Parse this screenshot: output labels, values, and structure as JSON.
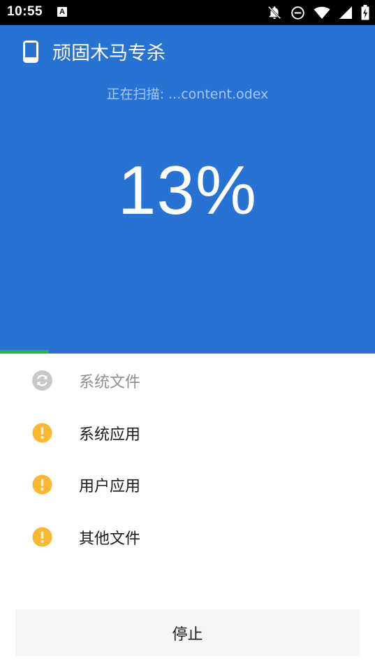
{
  "status_bar": {
    "time": "10:55",
    "notification_glyph": "A",
    "icons": [
      "notifications-off-icon",
      "do-not-disturb-icon",
      "wifi-icon",
      "cell-signal-icon",
      "battery-charging-icon"
    ]
  },
  "header": {
    "title": "顽固木马专杀",
    "scan_status": "正在扫描: ...content.odex",
    "percent_label": "13%",
    "icon": "phone-icon"
  },
  "progress": {
    "fraction": 0.13
  },
  "scan_items": [
    {
      "label": "系统文件",
      "state": "scanning",
      "icon": "refresh-icon"
    },
    {
      "label": "系统应用",
      "state": "pending",
      "icon": "warning-icon"
    },
    {
      "label": "用户应用",
      "state": "pending",
      "icon": "warning-icon"
    },
    {
      "label": "其他文件",
      "state": "pending",
      "icon": "warning-icon"
    }
  ],
  "actions": {
    "stop_label": "停止"
  },
  "colors": {
    "header_bg": "#2872d4",
    "progress": "#1fb84a",
    "warning": "#fbb72f",
    "scanning_icon": "#c8c8c8"
  }
}
